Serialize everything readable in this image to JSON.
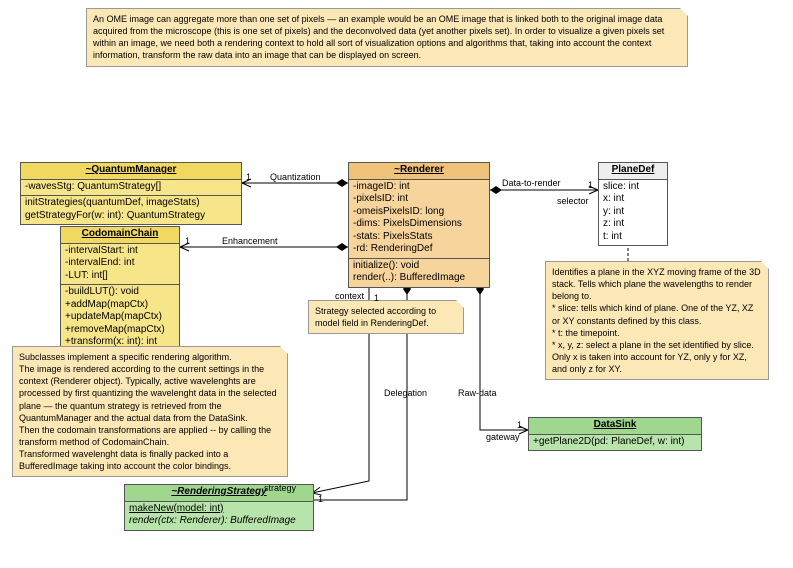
{
  "notes": {
    "top": "An OME image can aggregate more than one set of pixels — an example would be an OME image that is linked both to the original image data acquired from the microscope (this is one set of pixels) and the deconvolved data (yet another pixels set). In order to visualize a given pixels set within an image, we need both a rendering context to hold all sort of visualization options and algorithms that, taking into account the context information, transform the raw data into an image that can be displayed on screen.",
    "planedef": "Identifies a plane in the XYZ moving frame of the 3D stack. Tells which plane the wavelengths to render belong to.\n* slice: tells which kind of plane. One of the YZ, XZ or XY constants defined by this class.\n* t: the timepoint.\n* x, y, z: select a plane in the set identified by slice. Only x is taken into account for YZ, only y for XZ, and only z for XY.",
    "subclasses": "Subclasses implement a specific rendering algorithm.\nThe image is rendered according to the current settings in the context (Renderer object). Typically, active wavelenghts are processed by first quantizing the wavelenght data in the selected plane — the quantum strategy is retrieved from the QuantumManager and the actual data from the DataSink.\nThen the codomain transformations are applied -- by calling the transform method of CodomainChain.\nTransformed wavelenght data is finally packed into a BufferedImage taking into account the color bindings.",
    "strategy": "Strategy selected according to model field in RenderingDef."
  },
  "classes": {
    "quantumManager": {
      "name": "~QuantumManager",
      "attrs": "-wavesStg: QuantumStrategy[]",
      "ops": "initStrategies(quantumDef, imageStats)\ngetStrategyFor(w: int): QuantumStrategy"
    },
    "codomainChain": {
      "name": "CodomainChain",
      "attrs": "-intervalStart: int\n-intervalEnd: int\n-LUT: int[]",
      "ops": "-buildLUT(): void\n+addMap(mapCtx)\n+updateMap(mapCtx)\n+removeMap(mapCtx)\n+transform(x: int): int"
    },
    "renderer": {
      "name": "~Renderer",
      "attrs": "-imageID: int\n-pixelsID: int\n-omeisPixelsID: long\n-dims: PixelsDimensions\n-stats: PixelsStats\n-rd: RenderingDef",
      "ops": "initialize(): void\nrender(..): BufferedImage"
    },
    "planeDef": {
      "name": "PlaneDef",
      "attrs": "slice: int\nx: int\ny: int\nz: int\nt: int"
    },
    "dataSink": {
      "name": "DataSink",
      "ops": "+getPlane2D(pd: PlaneDef, w: int)"
    },
    "renderingStrategy": {
      "name": "~RenderingStrategy",
      "ops_static": "makeNew(model: int)",
      "ops_abstract": "render(ctx: Renderer): BufferedImage"
    }
  },
  "labels": {
    "quantization": "Quantization",
    "enhancement": "Enhancement",
    "dataToRender": "Data-to-render",
    "selector": "selector",
    "context": "context",
    "delegation": "Delegation",
    "rawData": "Raw-data",
    "gateway": "gateway",
    "strategy": "strategy",
    "one": "1"
  }
}
